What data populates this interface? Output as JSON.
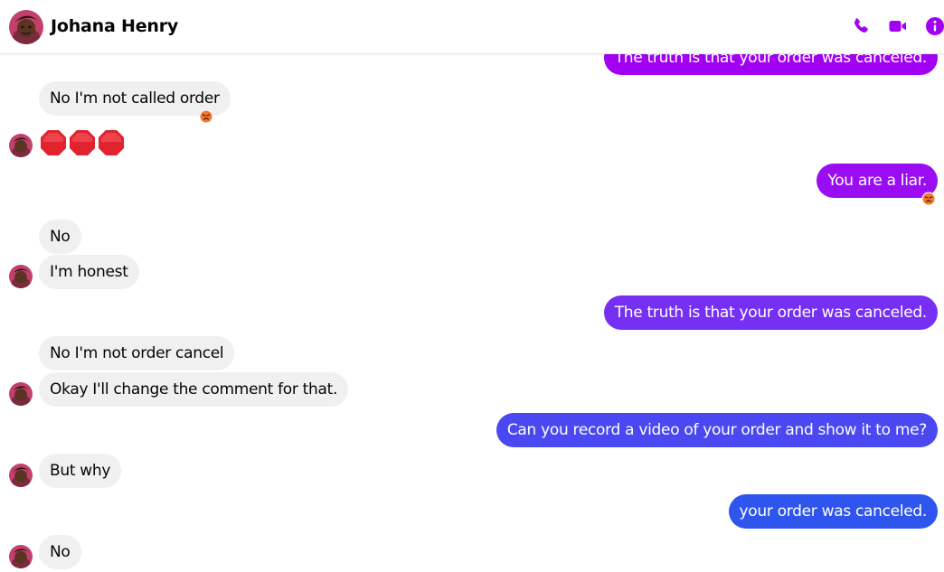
{
  "contact": {
    "name": "Johana Henry"
  },
  "header": {
    "icons": [
      "phone-icon",
      "video-camera-icon",
      "info-icon"
    ],
    "accent": "#a100f2"
  },
  "messages": {
    "m0": "The truth is that your order was canceled.",
    "m1": "No I'm not called order",
    "m2_emojis": [
      "🛑",
      "🛑",
      "🛑"
    ],
    "m3": "You are a liar.",
    "m4": "No",
    "m5": "I'm honest",
    "m6": "The truth is that your order was canceled.",
    "m7": "No I'm not order cancel",
    "m8": "Okay I'll change the comment for that.",
    "m9": "Can you record a video of your order and show it to me?",
    "m10": "But why",
    "m11": "your order was canceled.",
    "m12": "No"
  },
  "reactions": {
    "m1": "angry-face-emoji",
    "m3": "angry-face-emoji"
  },
  "colors": {
    "incoming_bubble": "#f0f0f0",
    "outgoing_gradient_top": "#a100f2",
    "outgoing_gradient_mid": "#7b2cf5",
    "outgoing_gradient_bottom": "#2a5bf0"
  }
}
